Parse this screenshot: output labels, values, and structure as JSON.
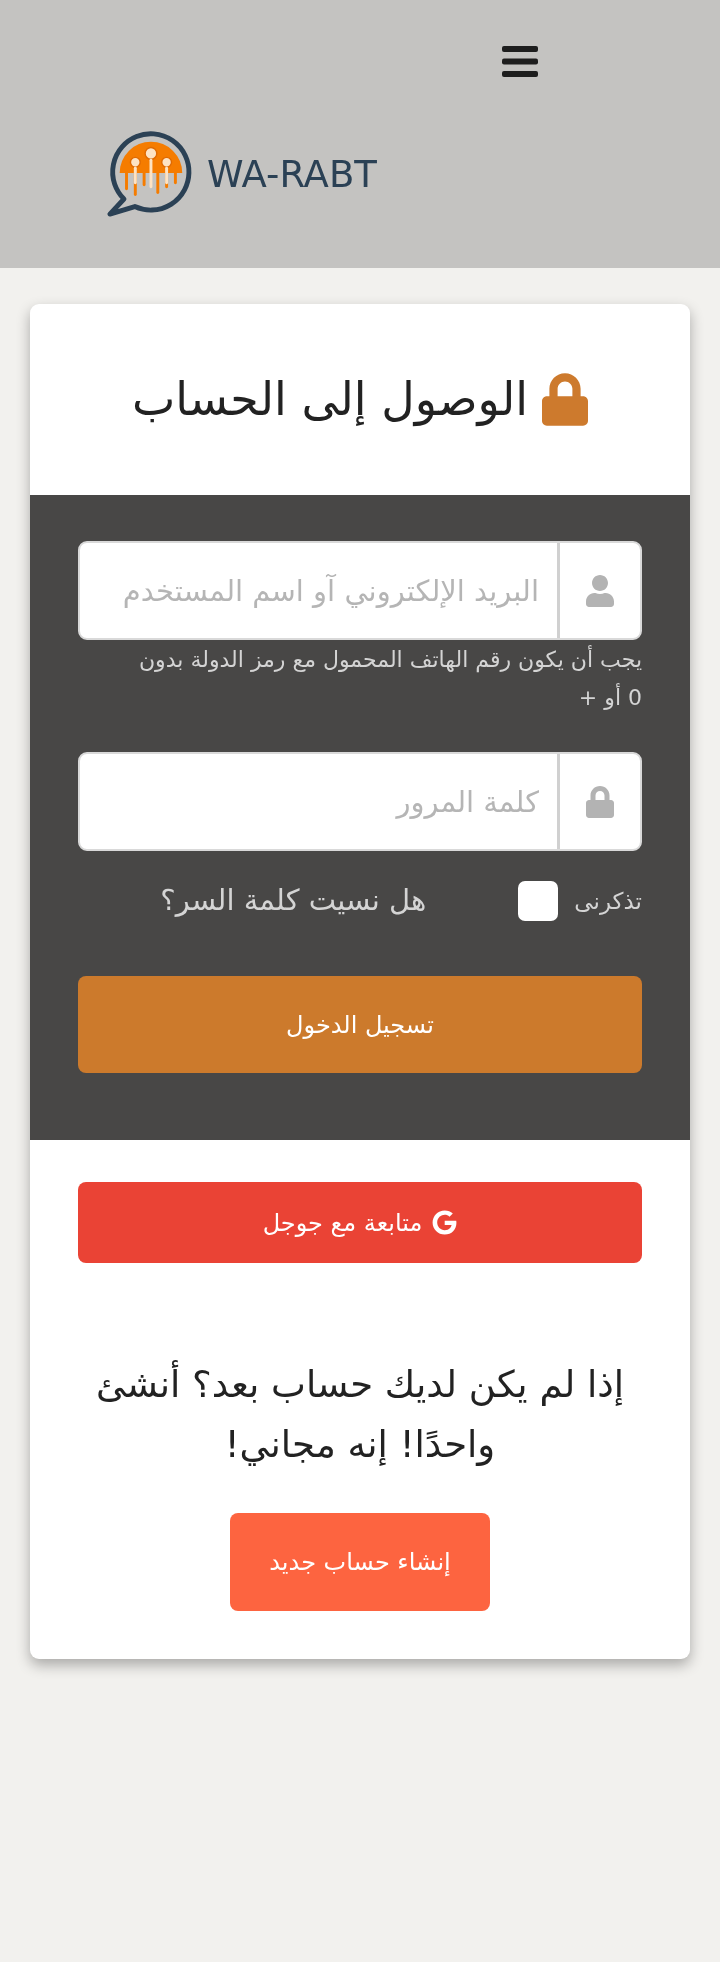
{
  "header": {
    "brand": "WA-RABT"
  },
  "login": {
    "title": "الوصول إلى الحساب",
    "fields": [
      {
        "kind": "username",
        "placeholder": "البريد الإلكتروني آو اسم المستخدم",
        "hint": "يجب أن يكون رقم الهاتف المحمول مع رمز الدولة بدون 0 أو +"
      },
      {
        "kind": "password",
        "placeholder": "كلمة المرور"
      }
    ],
    "remember": {
      "label": "تذكرنى",
      "checked": false
    },
    "forgot_link": "هل نسيت كلمة السر؟",
    "submit_button": "تسجيل الدخول"
  },
  "social": {
    "google_button": "متابعة مع جوجل"
  },
  "signup": {
    "prompt": "إذا لم يكن لديك حساب بعد؟ أنشئ واحدًا! إنه مجاني!",
    "button": "إنشاء حساب جديد"
  }
}
